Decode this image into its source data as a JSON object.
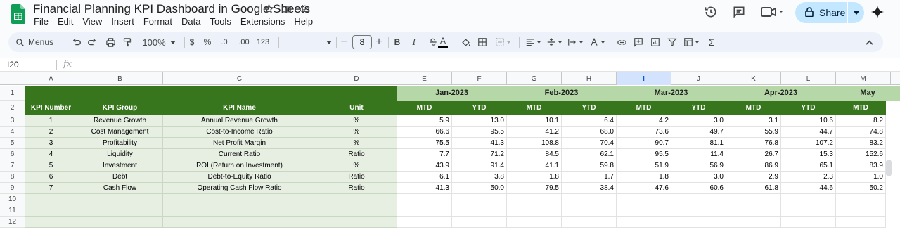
{
  "doc": {
    "title": "Financial Planning KPI Dashboard in Google Sheets"
  },
  "menu": [
    "File",
    "Edit",
    "View",
    "Insert",
    "Format",
    "Data",
    "Tools",
    "Extensions",
    "Help"
  ],
  "share": {
    "label": "Share"
  },
  "toolbar": {
    "menus_label": "Menus",
    "zoom": "100%",
    "currency": "$",
    "percent": "%",
    "dec_decrease": ".0",
    "dec_increase": ".00",
    "number_format": "123",
    "font_size": "8",
    "bold": "B",
    "italic": "I",
    "text_color_glyph": "A"
  },
  "formula_bar": {
    "cell_ref": "I20",
    "fx": "fx"
  },
  "columns": [
    "A",
    "B",
    "C",
    "D",
    "E",
    "F",
    "G",
    "H",
    "I",
    "J",
    "K",
    "L",
    "M"
  ],
  "selected_column": "I",
  "row_numbers": [
    "1",
    "2",
    "3",
    "4",
    "5",
    "6",
    "7",
    "8",
    "9",
    "10",
    "11",
    "12"
  ],
  "months": [
    "Jan-2023",
    "Feb-2023",
    "Mar-2023",
    "Apr-2023",
    "May"
  ],
  "headers": {
    "kpi_number": "KPI Number",
    "kpi_group": "KPI Group",
    "kpi_name": "KPI Name",
    "unit": "Unit",
    "mtd": "MTD",
    "ytd": "YTD"
  },
  "kpis": [
    {
      "num": "1",
      "group": "Revenue Growth",
      "name": "Annual Revenue Growth",
      "unit": "%",
      "values": [
        "5.9",
        "13.0",
        "10.1",
        "6.4",
        "4.2",
        "3.0",
        "3.1",
        "10.6",
        "8.2"
      ]
    },
    {
      "num": "2",
      "group": "Cost Management",
      "name": "Cost-to-Income Ratio",
      "unit": "%",
      "values": [
        "66.6",
        "95.5",
        "41.2",
        "68.0",
        "73.6",
        "49.7",
        "55.9",
        "44.7",
        "74.8"
      ]
    },
    {
      "num": "3",
      "group": "Profitability",
      "name": "Net Profit Margin",
      "unit": "%",
      "values": [
        "75.5",
        "41.3",
        "108.8",
        "70.4",
        "90.7",
        "81.1",
        "76.8",
        "107.2",
        "83.2"
      ]
    },
    {
      "num": "4",
      "group": "Liquidity",
      "name": "Current Ratio",
      "unit": "Ratio",
      "values": [
        "7.7",
        "71.2",
        "84.5",
        "62.1",
        "95.5",
        "11.4",
        "26.7",
        "15.3",
        "152.6"
      ]
    },
    {
      "num": "5",
      "group": "Investment",
      "name": "ROI (Return on Investment)",
      "unit": "%",
      "values": [
        "43.9",
        "91.4",
        "41.1",
        "59.8",
        "51.9",
        "56.9",
        "86.9",
        "65.1",
        "83.9"
      ]
    },
    {
      "num": "6",
      "group": "Debt",
      "name": "Debt-to-Equity Ratio",
      "unit": "Ratio",
      "values": [
        "6.1",
        "3.8",
        "1.8",
        "1.7",
        "1.8",
        "3.0",
        "2.9",
        "2.3",
        "1.0"
      ]
    },
    {
      "num": "7",
      "group": "Cash Flow",
      "name": "Operating Cash Flow Ratio",
      "unit": "Ratio",
      "values": [
        "41.3",
        "50.0",
        "79.5",
        "38.4",
        "47.6",
        "60.6",
        "61.8",
        "44.6",
        "50.2"
      ]
    }
  ],
  "colors": {
    "header_dark_green": "#38761d",
    "month_light_green": "#b6d7a8",
    "pale_green": "#e6efe2",
    "share_blue": "#c2e7ff"
  }
}
